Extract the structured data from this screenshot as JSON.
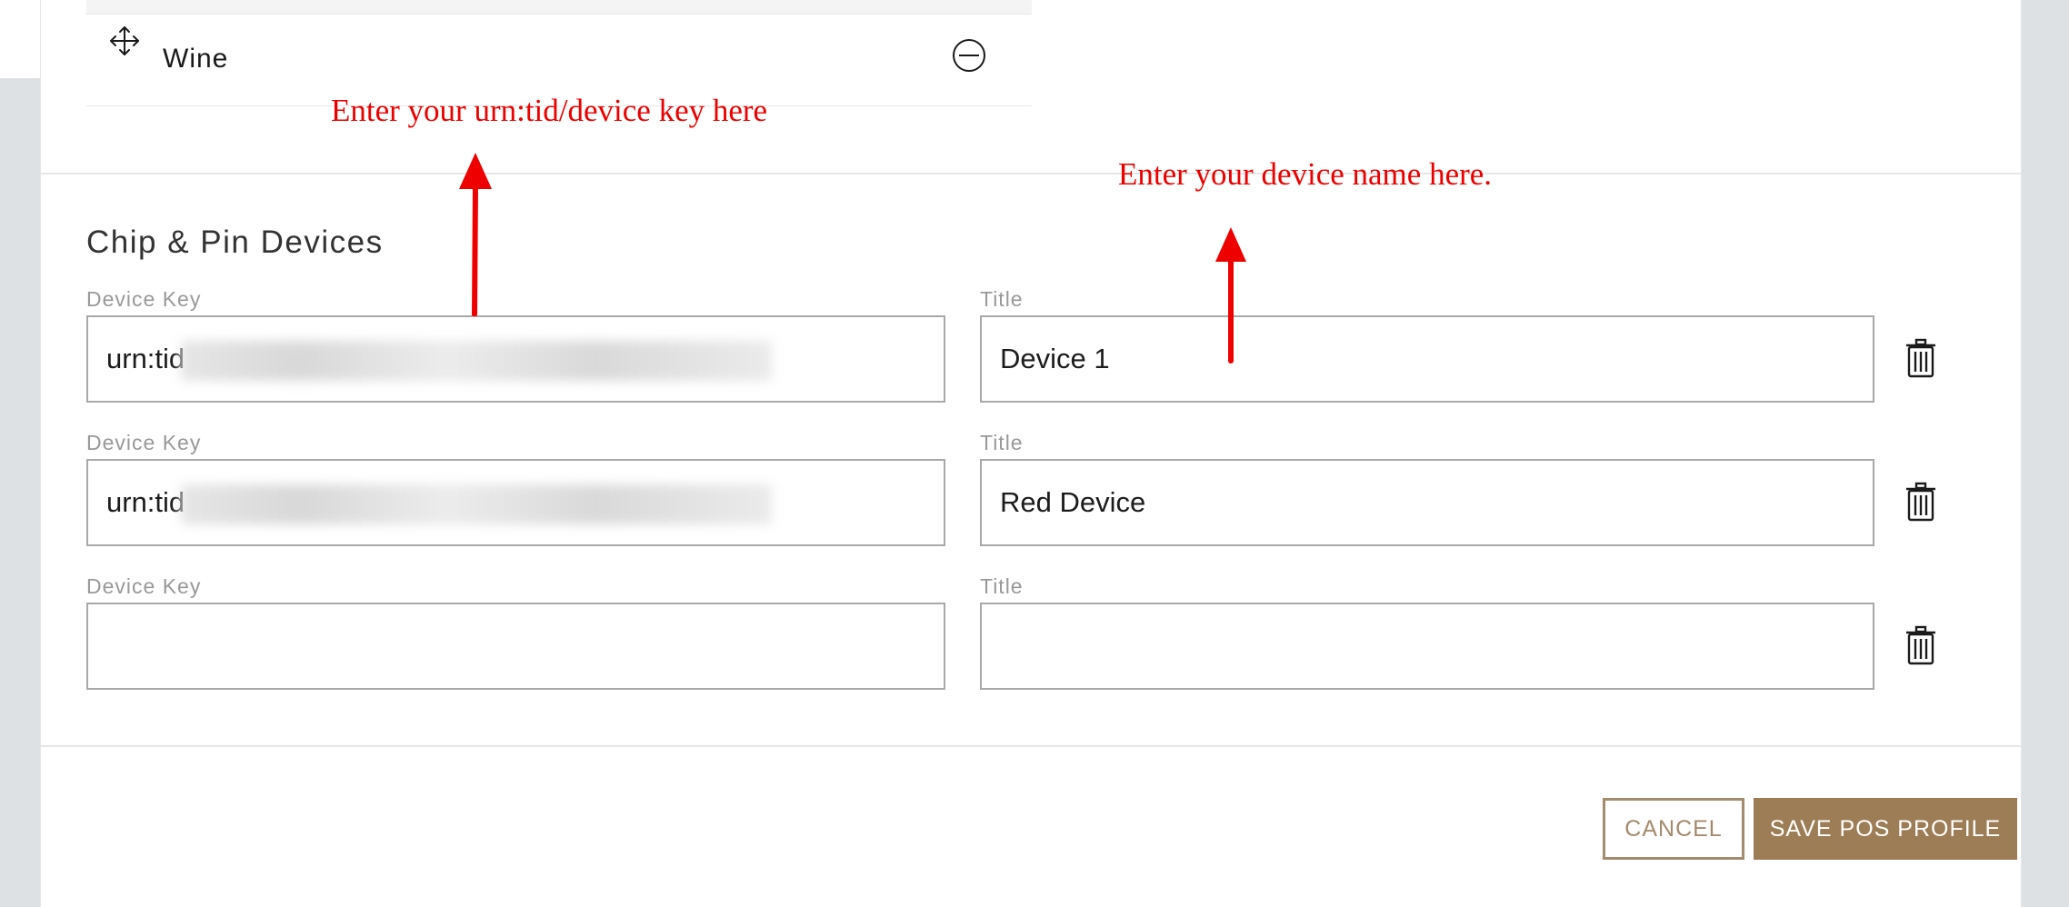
{
  "category_list": {
    "item_label": "Wine"
  },
  "section": {
    "title": "Chip & Pin Devices"
  },
  "devices": [
    {
      "key_label": "Device Key",
      "key_value": "urn:tid",
      "title_label": "Title",
      "title_value": "Device 1"
    },
    {
      "key_label": "Device Key",
      "key_value": "urn:tid",
      "title_label": "Title",
      "title_value": "Red Device"
    },
    {
      "key_label": "Device Key",
      "key_value": "",
      "title_label": "Title",
      "title_value": ""
    }
  ],
  "annotations": {
    "key_hint": "Enter your urn:tid/device key here",
    "title_hint": "Enter your device name here.",
    "color": "#ee0000"
  },
  "actions": {
    "cancel_label": "CANCEL",
    "save_label": "SAVE POS PROFILE"
  },
  "colors": {
    "accent": "#9d7d56",
    "background": "#dde1e3"
  }
}
